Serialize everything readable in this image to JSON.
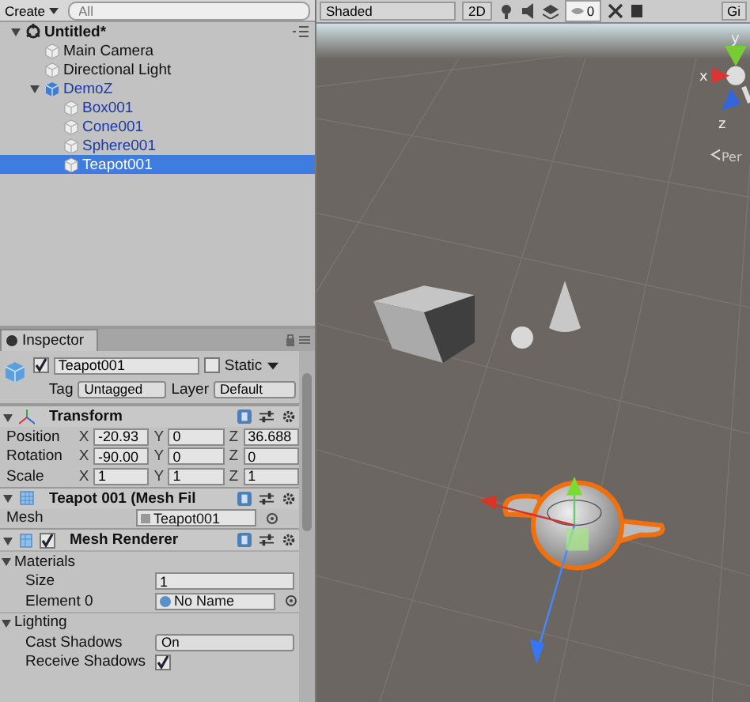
{
  "hierarchy": {
    "create_button": "Create",
    "search": {
      "placeholder": "All"
    },
    "tree": [
      {
        "label": "Untitled*",
        "kind": "scene",
        "expanded": true,
        "selected": false,
        "children": [
          {
            "label": "Main Camera",
            "kind": "object",
            "selected": false
          },
          {
            "label": "Directional Light",
            "kind": "object",
            "selected": false
          },
          {
            "label": "DemoZ",
            "kind": "prefab",
            "expanded": true,
            "selected": false,
            "children": [
              {
                "label": "Box001",
                "kind": "prefab_child",
                "selected": false
              },
              {
                "label": "Cone001",
                "kind": "prefab_child",
                "selected": false
              },
              {
                "label": "Sphere001",
                "kind": "prefab_child",
                "selected": false
              },
              {
                "label": "Teapot001",
                "kind": "prefab_child",
                "selected": true
              }
            ]
          }
        ]
      }
    ]
  },
  "inspector": {
    "tab": "Inspector",
    "object": {
      "active": true,
      "name": "Teapot001",
      "static": false,
      "static_label": "Static",
      "tag_label": "Tag",
      "tag": "Untagged",
      "layer_label": "Layer",
      "layer": "Default"
    },
    "components": [
      {
        "kind": "transform",
        "title": "Transform",
        "expanded": true,
        "rows": [
          {
            "label": "Position",
            "fields": [
              {
                "axis": "X",
                "value": "-20.93"
              },
              {
                "axis": "Y",
                "value": "0"
              },
              {
                "axis": "Z",
                "value": "36.688"
              }
            ]
          },
          {
            "label": "Rotation",
            "fields": [
              {
                "axis": "X",
                "value": "-90.00"
              },
              {
                "axis": "Y",
                "value": "0"
              },
              {
                "axis": "Z",
                "value": "0"
              }
            ]
          },
          {
            "label": "Scale",
            "fields": [
              {
                "axis": "X",
                "value": "1"
              },
              {
                "axis": "Y",
                "value": "1"
              },
              {
                "axis": "Z",
                "value": "1"
              }
            ]
          }
        ]
      },
      {
        "kind": "mesh_filter",
        "title": "Teapot 001 (Mesh Fil",
        "expanded": true,
        "rows": [
          {
            "label": "Mesh",
            "value": "Teapot001"
          }
        ]
      },
      {
        "kind": "mesh_renderer",
        "title": "Mesh Renderer",
        "expanded": true,
        "enabled": true,
        "sections": [
          {
            "label": "Materials",
            "expanded": true,
            "rows": [
              {
                "kind": "text",
                "label": "Size",
                "value": "1"
              },
              {
                "kind": "object",
                "label": "Element 0",
                "value": "No Name"
              }
            ]
          },
          {
            "label": "Lighting",
            "expanded": true,
            "rows": [
              {
                "kind": "dropdown",
                "label": "Cast Shadows",
                "value": "On"
              },
              {
                "kind": "checkbox",
                "label": "Receive Shadows",
                "checked": true
              }
            ]
          }
        ]
      }
    ]
  },
  "scene": {
    "toolbar": {
      "shading": "Shaded",
      "mode_2d": "2D",
      "hidden_count": "0",
      "gizmos": "Gi"
    },
    "gizmo": {
      "y": "y",
      "x": "x",
      "z": "z",
      "projection": "Per"
    }
  }
}
